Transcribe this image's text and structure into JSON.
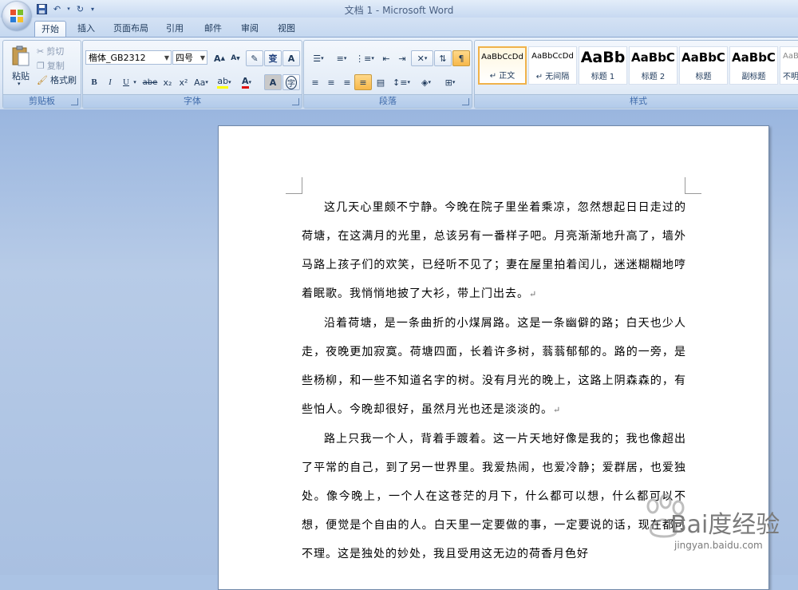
{
  "app": {
    "window_title": "文档 1 - Microsoft Word"
  },
  "colors": {
    "accent": "#f0b24a",
    "ribbon_text": "#1e395b",
    "group_title": "#3e6aaa"
  },
  "quick_access": {
    "icons": [
      "save-icon",
      "undo-icon",
      "redo-icon",
      "customize-icon"
    ]
  },
  "tabs": [
    {
      "label": "开始",
      "active": true
    },
    {
      "label": "插入"
    },
    {
      "label": "页面布局"
    },
    {
      "label": "引用"
    },
    {
      "label": "邮件"
    },
    {
      "label": "审阅"
    },
    {
      "label": "视图"
    }
  ],
  "ribbon": {
    "clipboard": {
      "title": "剪贴板",
      "paste": "粘贴",
      "cut": "剪切",
      "copy": "复制",
      "format_painter": "格式刷"
    },
    "font": {
      "title": "字体",
      "font_name": "楷体_GB2312",
      "font_size": "四号",
      "bold": "B",
      "italic": "I",
      "underline": "U",
      "strikethrough": "abe",
      "subscript": "x₂",
      "superscript": "x²",
      "change_case": "Aa",
      "phonetic": "变",
      "border": "A",
      "grow": "A",
      "shrink": "A",
      "font_color": "A",
      "char_shading": "A",
      "enclose": "字"
    },
    "paragraph": {
      "title": "段落"
    },
    "styles": {
      "title": "样式",
      "items": [
        {
          "sample": "AaBbCcDd",
          "name": "↵ 正文",
          "selected": true
        },
        {
          "sample": "AaBbCcDd",
          "name": "↵ 无间隔"
        },
        {
          "sample": "AaBb",
          "name": "标题 1"
        },
        {
          "sample": "AaBbC",
          "name": "标题 2"
        },
        {
          "sample": "AaBbC",
          "name": "标题"
        },
        {
          "sample": "AaBbC",
          "name": "副标题"
        },
        {
          "sample": "AaBb",
          "name": "不明"
        }
      ]
    }
  },
  "document": {
    "paragraphs": [
      "这几天心里颇不宁静。今晚在院子里坐着乘凉，忽然想起日日走过的荷塘，在这满月的光里，总该另有一番样子吧。月亮渐渐地升高了，墙外马路上孩子们的欢笑，已经听不见了；妻在屋里拍着闰儿，迷迷糊糊地哼着眠歌。我悄悄地披了大衫，带上门出去。",
      "沿着荷塘，是一条曲折的小煤屑路。这是一条幽僻的路；白天也少人走，夜晚更加寂寞。荷塘四面，长着许多树，蓊蓊郁郁的。路的一旁，是些杨柳，和一些不知道名字的树。没有月光的晚上，这路上阴森森的，有些怕人。今晚却很好，虽然月光也还是淡淡的。",
      "路上只我一个人，背着手踱着。这一片天地好像是我的；我也像超出了平常的自己，到了另一世界里。我爱热闹，也爱冷静；爱群居，也爱独处。像今晚上，一个人在这苍茫的月下，什么都可以想，什么都可以不想，便觉是个自由的人。白天里一定要做的事，一定要说的话，现在都可不理。这是独处的妙处，我且受用这无边的荷香月色好"
    ],
    "paragraph_mark": "↵"
  },
  "watermark": {
    "text": "Bai度经验",
    "url": "jingyan.baidu.com"
  }
}
